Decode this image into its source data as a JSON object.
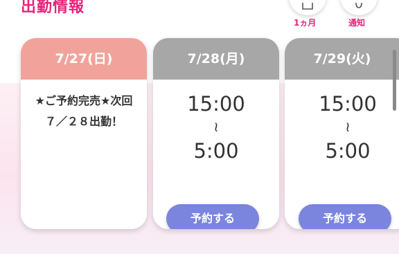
{
  "section": {
    "title": "出勤情報"
  },
  "header_buttons": {
    "month_label": "1ヵ月",
    "notify_label": "通知"
  },
  "schedule": [
    {
      "date": "7/27(日)",
      "status": "sold_out",
      "message": "★ご予約完売★次回７／２８出勤！"
    },
    {
      "date": "7/28(月)",
      "start": "15:00",
      "separator": "≀",
      "end": "5:00",
      "reserve_label": "予約する"
    },
    {
      "date": "7/29(火)",
      "start": "15:00",
      "separator": "≀",
      "end": "5:00",
      "reserve_label": "予約する"
    }
  ],
  "colors": {
    "accent": "#e8237a",
    "sold_out_header": "#f1a39b",
    "open_header": "#a7a7a7",
    "reserve_button": "#7b85de",
    "background_tint": "#fbe4ee"
  },
  "icons": {
    "month": "calendar-icon",
    "notify": "bell-icon"
  }
}
